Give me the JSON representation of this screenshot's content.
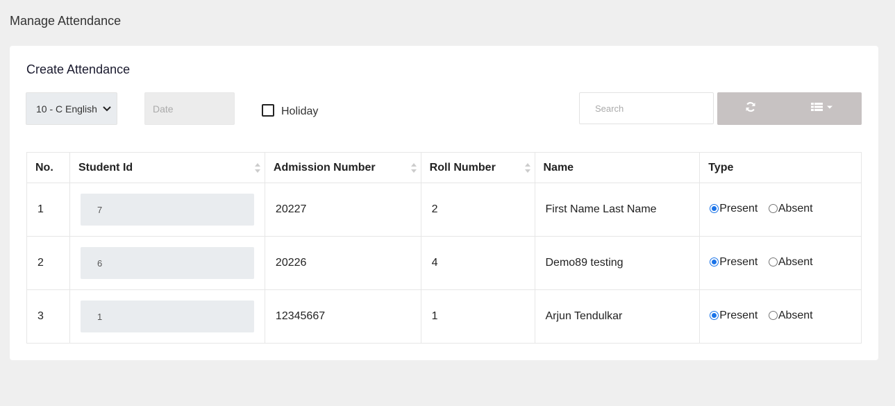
{
  "page": {
    "title": "Manage Attendance"
  },
  "card": {
    "title": "Create Attendance"
  },
  "filters": {
    "class_select": "10 - C English",
    "date_placeholder": "Date",
    "holiday_label": "Holiday",
    "holiday_checked": false,
    "search_placeholder": "Search"
  },
  "toolbar": {
    "refresh_icon": "refresh-icon",
    "columns_icon": "columns-list-icon"
  },
  "table": {
    "headers": [
      "No.",
      "Student Id",
      "Admission Number",
      "Roll Number",
      "Name",
      "Type"
    ],
    "rows": [
      {
        "no": "1",
        "student_id": "7",
        "admission": "20227",
        "roll": "2",
        "name": "First Name Last Name",
        "type": "Present"
      },
      {
        "no": "2",
        "student_id": "6",
        "admission": "20226",
        "roll": "4",
        "name": "Demo89 testing",
        "type": "Present"
      },
      {
        "no": "3",
        "student_id": "1",
        "admission": "12345667",
        "roll": "1",
        "name": "Arjun Tendulkar",
        "type": "Present"
      }
    ],
    "type_options": [
      "Present",
      "Absent"
    ]
  },
  "colors": {
    "accent": "#1a73e8",
    "button_bg": "#c7c2c2"
  }
}
